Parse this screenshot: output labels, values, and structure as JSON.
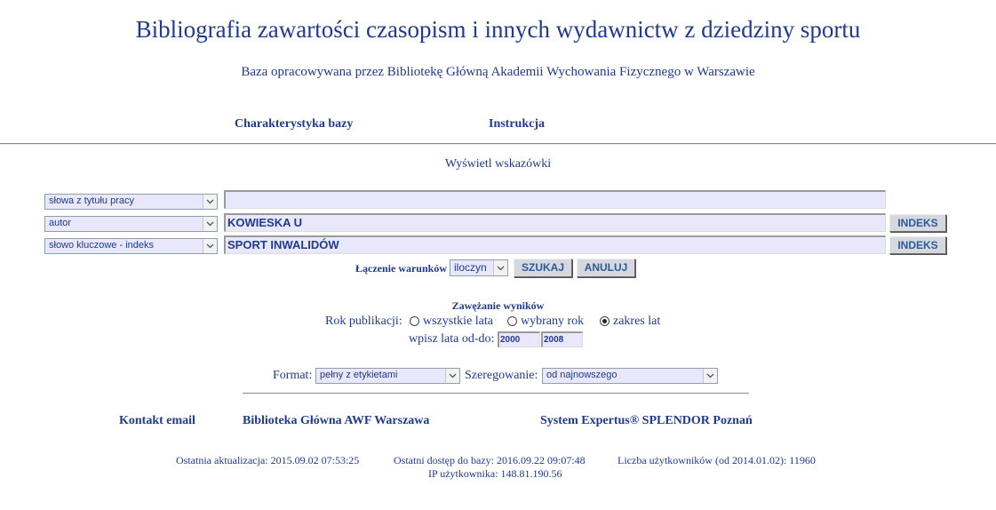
{
  "header": {
    "title": "Bibliografia zawartości czasopism i innych wydawnictw z dziedziny sportu",
    "subtitle": "Baza opracowywana przez Bibliotekę Główną Akademii Wychowania Fizycznego w Warszawie"
  },
  "nav": {
    "charakterystyka": "Charakterystyka bazy",
    "instrukcja": "Instrukcja"
  },
  "hints_link": "Wyświetl wskazówki",
  "search_rows": [
    {
      "field_select": "słowa z tytułu pracy",
      "value": "",
      "has_index_button": false
    },
    {
      "field_select": "autor",
      "value": "KOWIESKA U",
      "has_index_button": true
    },
    {
      "field_select": "słowo kluczowe - indeks",
      "value": "SPORT INWALIDÓW",
      "has_index_button": true
    }
  ],
  "index_button_label": "INDEKS",
  "combine": {
    "label": "Łączenie warunków",
    "selected": "iloczyn",
    "search_button": "SZUKAJ",
    "cancel_button": "ANULUJ"
  },
  "narrowing": {
    "heading": "Zawężanie wyników",
    "year_label": "Rok publikacji:",
    "options": [
      {
        "label": "wszystkie lata",
        "checked": false
      },
      {
        "label": "wybrany rok",
        "checked": false
      },
      {
        "label": "zakres lat",
        "checked": true
      }
    ],
    "range_label": "wpisz lata od-do:",
    "from": "2000",
    "to": "2008"
  },
  "output": {
    "format_label": "Format:",
    "format_value": "pełny z etykietami",
    "sort_label": "Szeregowanie:",
    "sort_value": "od najnowszego"
  },
  "footer": {
    "contact": "Kontakt email",
    "library": "Biblioteka Główna AWF Warszawa",
    "system": "System Expertus® SPLENDOR Poznań"
  },
  "stats": {
    "last_update": "Ostatnia aktualizacja: 2015.09.02 07:53:25",
    "last_access": "Ostatni dostęp do bazy: 2016.09.22 09:07:48",
    "users": "Liczba użytkowników (od 2014.01.02): 11960",
    "ip": "IP użytkownika: 148.81.190.56"
  },
  "colors": {
    "text_blue": "#1f3a8e",
    "field_bg": "#e8e8fa",
    "button_bg": "#d7d7df"
  }
}
